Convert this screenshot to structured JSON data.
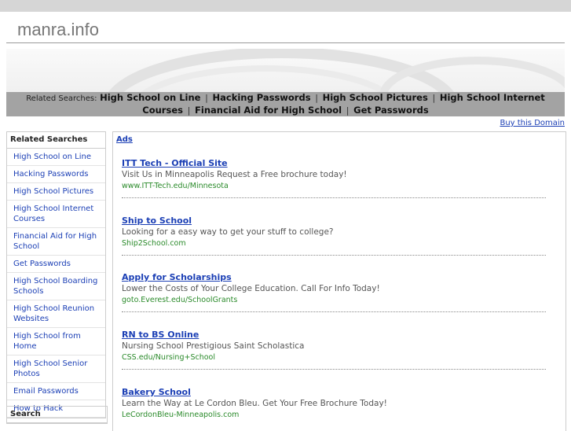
{
  "site": {
    "title": "manra.info"
  },
  "related_bar": {
    "label": "Related Searches:",
    "links": [
      "High School on Line",
      "Hacking Passwords",
      "High School Pictures",
      "High School Internet Courses",
      "Financial Aid for High School",
      "Get Passwords"
    ],
    "separator": "|"
  },
  "buy_domain": "Buy this Domain",
  "sidebar": {
    "heading": "Related Searches",
    "items": [
      "High School on Line",
      "Hacking Passwords",
      "High School Pictures",
      "High School Internet Courses",
      "Financial Aid for High School",
      "Get Passwords",
      "High School Boarding Schools",
      "High School Reunion Websites",
      "High School from Home",
      "High School Senior Photos",
      "Email Passwords",
      "How to Hack"
    ],
    "search_heading": "Search"
  },
  "main": {
    "ads_label": "Ads",
    "ads": [
      {
        "title": "ITT Tech - Official Site",
        "desc": "Visit Us in Minneapolis Request a Free brochure today!",
        "url": "www.ITT-Tech.edu/Minnesota"
      },
      {
        "title": "Ship to School",
        "desc": "Looking for a easy way to get your stuff to college?",
        "url": "Ship2School.com"
      },
      {
        "title": "Apply for Scholarships",
        "desc": "Lower the Costs of Your College Education. Call For Info Today!",
        "url": "goto.Everest.edu/SchoolGrants"
      },
      {
        "title": "RN to BS Online",
        "desc": "Nursing School Prestigious Saint Scholastica",
        "url": "CSS.edu/Nursing+School"
      },
      {
        "title": "Bakery School",
        "desc": "Learn the Way at Le Cordon Bleu. Get Your Free Brochure Today!",
        "url": "LeCordonBleu-Minneapolis.com"
      }
    ]
  }
}
